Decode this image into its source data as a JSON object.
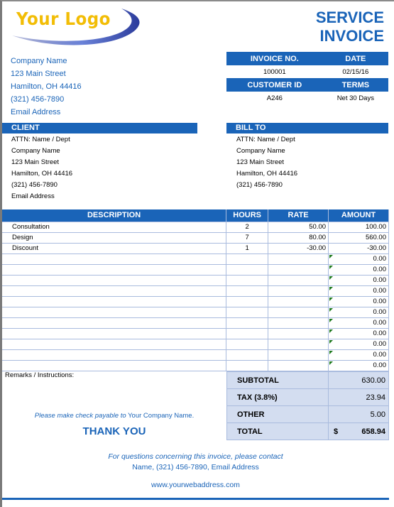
{
  "logo": {
    "text": "Your Logo",
    "text_color": "#f2bd06",
    "swoosh_color": "#3a4fb0"
  },
  "header": {
    "title_line1": "SERVICE",
    "title_line2": "INVOICE"
  },
  "company": {
    "name": "Company Name",
    "street": "123 Main Street",
    "city": "Hamilton, OH  44416",
    "phone": "(321) 456-7890",
    "email": "Email Address"
  },
  "invoice_meta": {
    "invoice_no_label": "INVOICE NO.",
    "date_label": "DATE",
    "invoice_no": "100001",
    "date": "02/15/16",
    "customer_id_label": "CUSTOMER ID",
    "terms_label": "TERMS",
    "customer_id": "A246",
    "terms": "Net 30 Days"
  },
  "client": {
    "heading": "CLIENT",
    "attn": "ATTN: Name / Dept",
    "company": "Company Name",
    "street": "123 Main Street",
    "city": "Hamilton, OH  44416",
    "phone": "(321) 456-7890",
    "email": "Email Address"
  },
  "bill_to": {
    "heading": "BILL TO",
    "attn": "ATTN: Name / Dept",
    "company": "Company Name",
    "street": "123 Main Street",
    "city": "Hamilton, OH  44416",
    "phone": "(321) 456-7890"
  },
  "items": {
    "headers": {
      "description": "DESCRIPTION",
      "hours": "HOURS",
      "rate": "RATE",
      "amount": "AMOUNT"
    },
    "rows": [
      {
        "description": "Consultation",
        "hours": "2",
        "rate": "50.00",
        "amount": "100.00"
      },
      {
        "description": "Design",
        "hours": "7",
        "rate": "80.00",
        "amount": "560.00"
      },
      {
        "description": "Discount",
        "hours": "1",
        "rate": "-30.00",
        "amount": "-30.00"
      },
      {
        "description": "",
        "hours": "",
        "rate": "",
        "amount": "0.00"
      },
      {
        "description": "",
        "hours": "",
        "rate": "",
        "amount": "0.00"
      },
      {
        "description": "",
        "hours": "",
        "rate": "",
        "amount": "0.00"
      },
      {
        "description": "",
        "hours": "",
        "rate": "",
        "amount": "0.00"
      },
      {
        "description": "",
        "hours": "",
        "rate": "",
        "amount": "0.00"
      },
      {
        "description": "",
        "hours": "",
        "rate": "",
        "amount": "0.00"
      },
      {
        "description": "",
        "hours": "",
        "rate": "",
        "amount": "0.00"
      },
      {
        "description": "",
        "hours": "",
        "rate": "",
        "amount": "0.00"
      },
      {
        "description": "",
        "hours": "",
        "rate": "",
        "amount": "0.00"
      },
      {
        "description": "",
        "hours": "",
        "rate": "",
        "amount": "0.00"
      },
      {
        "description": "",
        "hours": "",
        "rate": "",
        "amount": "0.00"
      }
    ]
  },
  "remarks_label": "Remarks / Instructions:",
  "check_note": {
    "italic": "Please make check payable to",
    "company": "Your Company Name."
  },
  "thank_you": "THANK YOU",
  "totals": {
    "subtotal_label": "SUBTOTAL",
    "subtotal": "630.00",
    "tax_label": "TAX (3.8%)",
    "tax": "23.94",
    "other_label": "OTHER",
    "other": "5.00",
    "total_label": "TOTAL",
    "currency": "$",
    "total": "658.94"
  },
  "footer": {
    "question": "For questions concerning this invoice, please contact",
    "contact": "Name, (321) 456-7890, Email Address",
    "website": "www.yourwebaddress.com"
  },
  "colors": {
    "accent": "#1a64b8",
    "totals_bg": "#d3ddf0",
    "grid": "#a9bbde",
    "flag": "#1e7a1e"
  }
}
